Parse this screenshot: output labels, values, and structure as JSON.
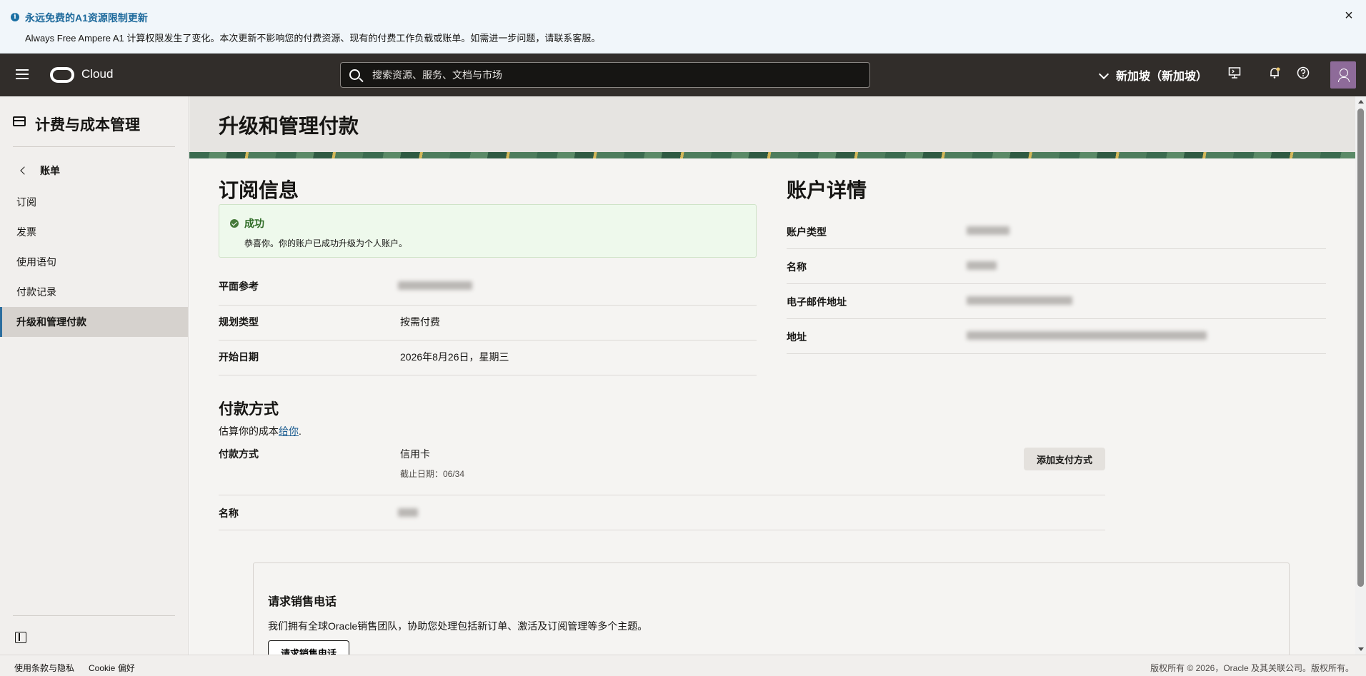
{
  "banner": {
    "title": "永远免费的A1资源限制更新",
    "message": "Always Free Ampere A1 计算权限发生了变化。本次更新不影响您的付费资源、现有的付费工作负载或账单。如需进一步问题，请联系客服。",
    "close_glyph": "×"
  },
  "topnav": {
    "brand": "Cloud",
    "search_placeholder": "搜索资源、服务、文档与市场",
    "region": "新加坡（新加坡）"
  },
  "sidebar": {
    "title": "计费与成本管理",
    "back_label": "账单",
    "items": [
      {
        "label": "订阅"
      },
      {
        "label": "发票"
      },
      {
        "label": "使用语句"
      },
      {
        "label": "付款记录"
      },
      {
        "label": "升级和管理付款"
      }
    ],
    "active_index": 4
  },
  "page": {
    "title": "升级和管理付款"
  },
  "subscription": {
    "heading": "订阅信息",
    "success_title": "成功",
    "success_message": "恭喜你。你的账户已成功升级为个人账户。",
    "rows": [
      {
        "label": "平面参考",
        "value": ""
      },
      {
        "label": "规划类型",
        "value": "按需付费"
      },
      {
        "label": "开始日期",
        "value": "2026年8月26日，星期三"
      }
    ]
  },
  "account": {
    "heading": "账户详情",
    "rows": [
      {
        "label": "账户类型"
      },
      {
        "label": "名称"
      },
      {
        "label": "电子邮件地址"
      },
      {
        "label": "地址"
      }
    ]
  },
  "payment": {
    "heading": "付款方式",
    "subtext": "估算你的成本",
    "subtext_link": "给你",
    "subtext_end": ".",
    "method_label": "付款方式",
    "method_value": "信用卡",
    "expiry": "截止日期：06/34",
    "name_label": "名称",
    "add_button": "添加支付方式"
  },
  "sales": {
    "title": "请求销售电话",
    "message": "我们拥有全球Oracle销售团队，协助您处理包括新订单、激活及订阅管理等多个主题。",
    "button": "请求销售电话"
  },
  "footer": {
    "terms": "使用条款与隐私",
    "cookies": "Cookie 偏好",
    "copyright": "版权所有 © 2026，Oracle 及其关联公司。版权所有。"
  }
}
